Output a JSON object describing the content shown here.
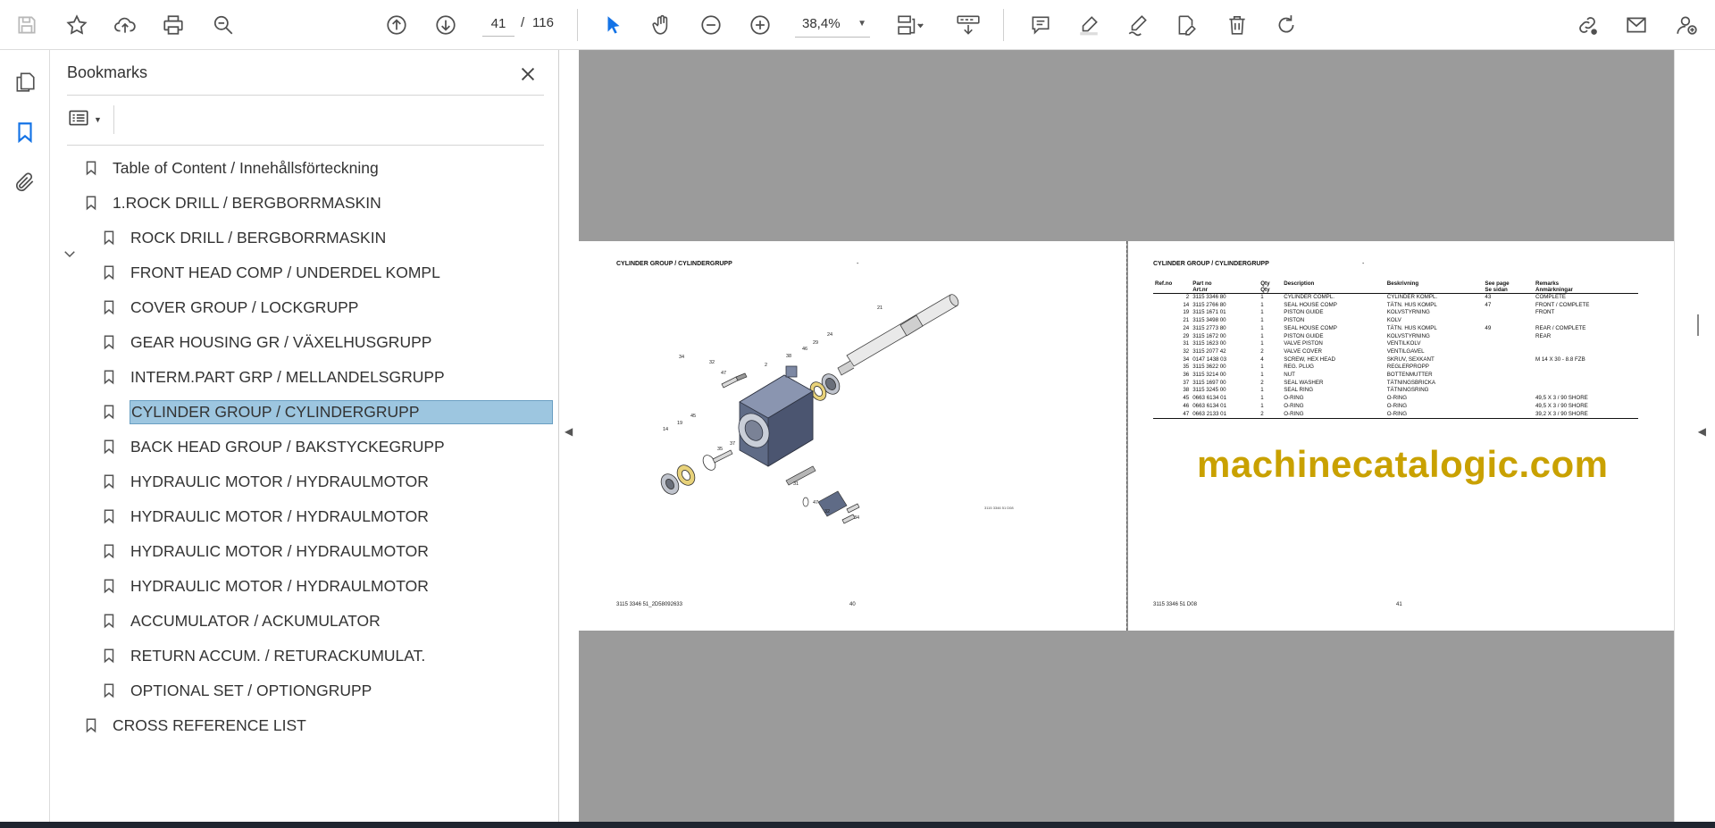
{
  "toolbar": {
    "current_page": "41",
    "page_separator": "/",
    "total_pages": "116",
    "zoom": "38,4%"
  },
  "bookmarks": {
    "title": "Bookmarks",
    "items": [
      {
        "label": "Table of Content / Innehållsförteckning",
        "level": 0
      },
      {
        "label": "1.ROCK DRILL / BERGBORRMASKIN",
        "level": 0,
        "expanded": true
      },
      {
        "label": "ROCK DRILL / BERGBORRMASKIN",
        "level": 1
      },
      {
        "label": "FRONT HEAD COMP / UNDERDEL KOMPL",
        "level": 1
      },
      {
        "label": "COVER GROUP / LOCKGRUPP",
        "level": 1
      },
      {
        "label": "GEAR HOUSING GR / VÄXELHUSGRUPP",
        "level": 1
      },
      {
        "label": "INTERM.PART GRP / MELLANDELSGRUPP",
        "level": 1
      },
      {
        "label": "CYLINDER GROUP / CYLINDERGRUPP",
        "level": 1,
        "selected": true
      },
      {
        "label": "BACK HEAD GROUP / BAKSTYCKEGRUPP",
        "level": 1
      },
      {
        "label": "HYDRAULIC MOTOR / HYDRAULMOTOR",
        "level": 1
      },
      {
        "label": "HYDRAULIC MOTOR / HYDRAULMOTOR",
        "level": 1
      },
      {
        "label": "HYDRAULIC MOTOR / HYDRAULMOTOR",
        "level": 1
      },
      {
        "label": "HYDRAULIC MOTOR / HYDRAULMOTOR",
        "level": 1
      },
      {
        "label": "ACCUMULATOR / ACKUMULATOR",
        "level": 1
      },
      {
        "label": "RETURN ACCUM. / RETURACKUMULAT.",
        "level": 1
      },
      {
        "label": "OPTIONAL SET / OPTIONGRUPP",
        "level": 1
      },
      {
        "label": "CROSS REFERENCE LIST",
        "level": 0
      }
    ]
  },
  "document": {
    "watermark": "machinecatalogic.com",
    "left_page": {
      "heading": "CYLINDER GROUP / CYLINDERGRUPP",
      "dash": "-",
      "footer_left": "3115 3346 51_2D58092633",
      "footer_page": "40",
      "drawing_ref": "3115 3346 51 D08",
      "callouts": [
        "21",
        "24",
        "29",
        "46",
        "38",
        "2",
        "34",
        "32",
        "47",
        "19",
        "45",
        "14",
        "35",
        "37",
        "31",
        "47",
        "32",
        "34"
      ]
    },
    "right_page": {
      "heading": "CYLINDER GROUP / CYLINDERGRUPP",
      "dash": "-",
      "footer_left": "3115 3346 51 D08",
      "footer_page": "41",
      "table_headers": [
        [
          "Ref.no",
          ""
        ],
        [
          "Part no",
          "Art.nr"
        ],
        [
          "Qty",
          "Qty"
        ],
        [
          "Description",
          ""
        ],
        [
          "Beskrivning",
          ""
        ],
        [
          "See page",
          "Se sidan"
        ],
        [
          "Remarks",
          "Anmärkningar"
        ]
      ],
      "rows": [
        [
          "2",
          "3115 3346 80",
          "1",
          "CYLINDER COMPL.",
          "CYLINDER KOMPL.",
          "43",
          "COMPLETE"
        ],
        [
          "14",
          "3115 2766 80",
          "1",
          "SEAL HOUSE COMP",
          "TÄTN. HUS KOMPL",
          "47",
          "FRONT / COMPLETE"
        ],
        [
          "19",
          "3115 1671 01",
          "1",
          "PISTON GUIDE",
          "KOLVSTYRNING",
          "",
          "FRONT"
        ],
        [
          "21",
          "3115 3498 00",
          "1",
          "PISTON",
          "KOLV",
          "",
          ""
        ],
        [
          "24",
          "3115 2773 80",
          "1",
          "SEAL HOUSE COMP",
          "TÄTN. HUS KOMPL",
          "49",
          "REAR / COMPLETE"
        ],
        [
          "29",
          "3115 1672 00",
          "1",
          "PISTON GUIDE",
          "KOLVSTYRNING",
          "",
          "REAR"
        ],
        [
          "31",
          "3115 1623 00",
          "1",
          "VALVE PISTON",
          "VENTILKOLV",
          "",
          ""
        ],
        [
          "32",
          "3115 2077 42",
          "2",
          "VALVE COVER",
          "VENTILGAVEL",
          "",
          ""
        ],
        [
          "34",
          "0147 1438 03",
          "4",
          "SCREW, HEX HEAD",
          "SKRUV, SEXKANT",
          "",
          "M 14 X 30 - 8.8 FZB"
        ],
        [
          "35",
          "3115 3622 00",
          "1",
          "REG. PLUG",
          "REGLERPROPP",
          "",
          ""
        ],
        [
          "36",
          "3115 3214 00",
          "1",
          "NUT",
          "BOTTENMUTTER",
          "",
          ""
        ],
        [
          "37",
          "3115 1697 00",
          "2",
          "SEAL WASHER",
          "TÄTNINGSBRICKA",
          "",
          ""
        ],
        [
          "38",
          "3115 3245 00",
          "1",
          "SEAL RING",
          "TÄTNINGSRING",
          "",
          ""
        ],
        [
          "45",
          "0663 6134 01",
          "1",
          "O-RING",
          "O-RING",
          "",
          "49,5 X 3 / 90 SHORE"
        ],
        [
          "46",
          "0663 6134 01",
          "1",
          "O-RING",
          "O-RING",
          "",
          "49,5 X 3 / 90 SHORE"
        ],
        [
          "47",
          "0663 2133 01",
          "2",
          "O-RING",
          "O-RING",
          "",
          "39,2 X 3 / 90 SHORE"
        ]
      ]
    }
  },
  "colors": {
    "selection": "#9dc6e0",
    "accent_blue": "#1473e6",
    "canvas_gray": "#9b9b9b",
    "watermark": "#c9a100"
  },
  "icons": {
    "toolbar": [
      "save-icon",
      "star-icon",
      "upload-icon",
      "print-icon",
      "zoom-search-icon",
      "page-up-icon",
      "page-down-icon",
      "select-cursor-icon",
      "hand-icon",
      "zoom-out-icon",
      "zoom-in-icon",
      "fit-page-icon",
      "scroll-mode-icon",
      "comment-icon",
      "highlight-icon",
      "sign-icon",
      "edit-icon",
      "delete-icon",
      "rotate-icon",
      "share-link-icon",
      "email-icon",
      "account-icon"
    ],
    "rail": [
      "pages-icon",
      "bookmark-icon",
      "attachment-icon"
    ]
  }
}
